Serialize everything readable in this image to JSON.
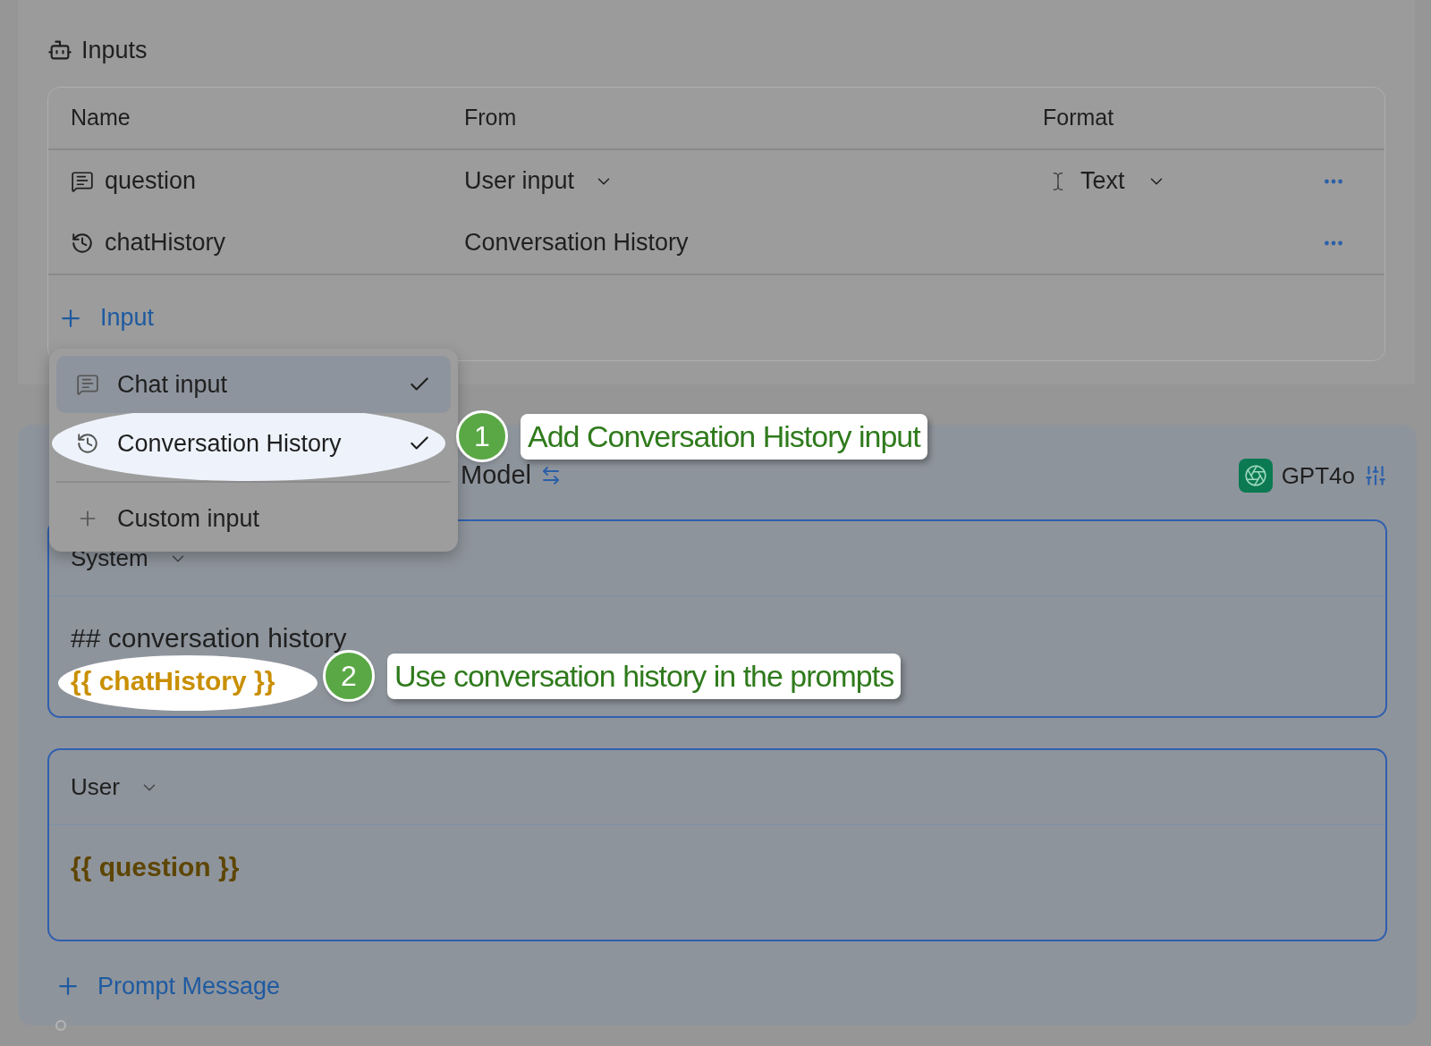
{
  "inputs_section": {
    "title": "Inputs",
    "columns": [
      "Name",
      "From",
      "Format"
    ],
    "rows": [
      {
        "kind": "chat",
        "name": "question",
        "from": "User input",
        "format": "Text"
      },
      {
        "kind": "history",
        "name": "chatHistory",
        "from": "Conversation History"
      }
    ],
    "add_button": "Input"
  },
  "input_menu": {
    "items": [
      {
        "kind": "chat",
        "label": "Chat input",
        "checked": true,
        "circled": false
      },
      {
        "kind": "history",
        "label": "Conversation History",
        "checked": true,
        "circled": true
      },
      {
        "kind": "custom",
        "label": "Custom input",
        "checked": false,
        "circled": false
      }
    ]
  },
  "model_section": {
    "title": "Model",
    "model_name": "GPT4o",
    "messages": [
      {
        "role": "System",
        "lines": [
          {
            "kind": "text",
            "text": "## conversation history",
            "circled": false
          },
          {
            "kind": "variable",
            "text": "{{ chatHistory }}",
            "circled": true
          }
        ]
      },
      {
        "role": "User",
        "lines": [
          {
            "kind": "variable",
            "text": "{{ question }}",
            "circled": false
          }
        ]
      }
    ],
    "add_button": "Prompt Message"
  },
  "annotations": [
    {
      "number": "1",
      "text": "Add Conversation History input"
    },
    {
      "number": "2",
      "text": "Use conversation history in the prompts"
    }
  ]
}
